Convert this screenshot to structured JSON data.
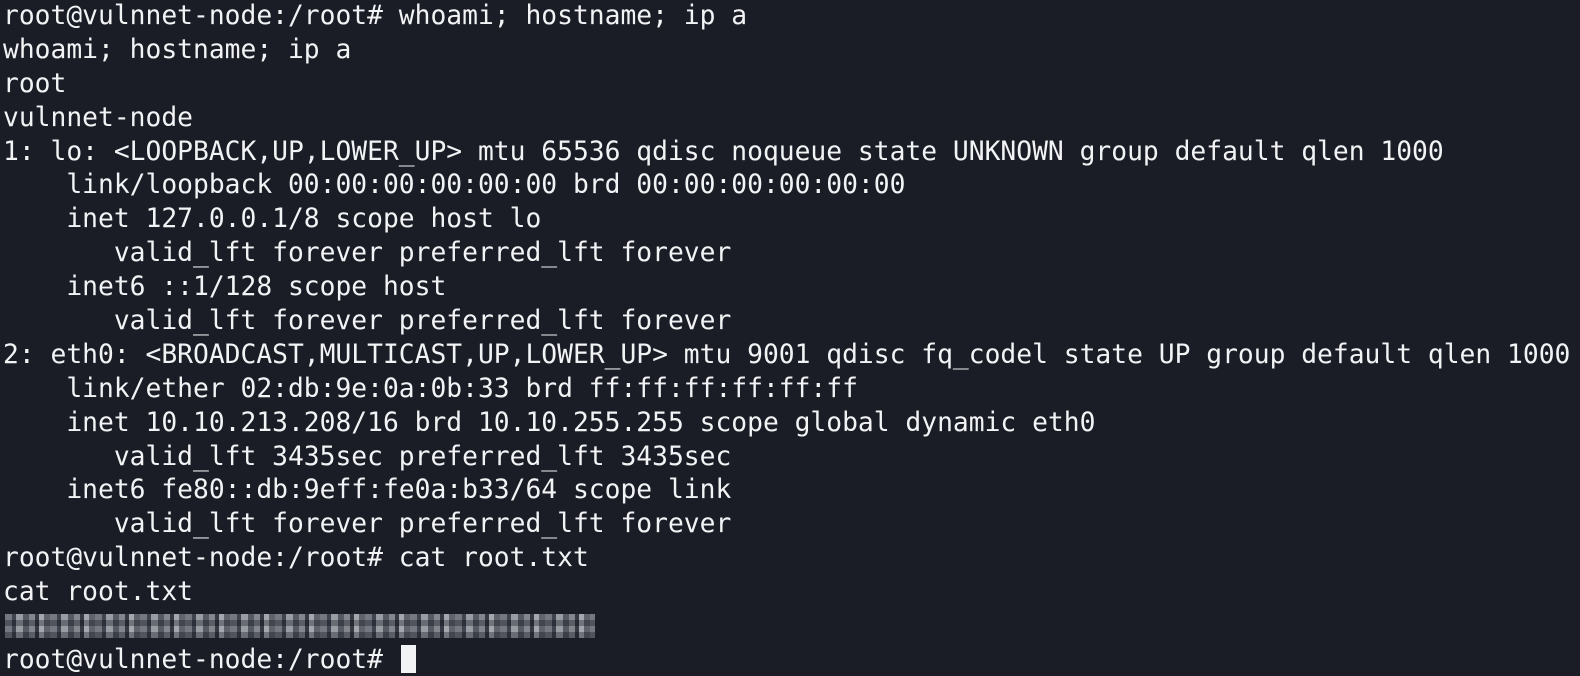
{
  "terminal": {
    "lines": [
      "root@vulnnet-node:/root# whoami; hostname; ip a",
      "whoami; hostname; ip a",
      "root",
      "vulnnet-node",
      "1: lo: <LOOPBACK,UP,LOWER_UP> mtu 65536 qdisc noqueue state UNKNOWN group default qlen 1000",
      "    link/loopback 00:00:00:00:00:00 brd 00:00:00:00:00:00",
      "    inet 127.0.0.1/8 scope host lo",
      "       valid_lft forever preferred_lft forever",
      "    inet6 ::1/128 scope host",
      "       valid_lft forever preferred_lft forever",
      "2: eth0: <BROADCAST,MULTICAST,UP,LOWER_UP> mtu 9001 qdisc fq_codel state UP group default qlen 1000",
      "    link/ether 02:db:9e:0a:0b:33 brd ff:ff:ff:ff:ff:ff",
      "    inet 10.10.213.208/16 brd 10.10.255.255 scope global dynamic eth0",
      "       valid_lft 3435sec preferred_lft 3435sec",
      "    inet6 fe80::db:9eff:fe0a:b33/64 scope link",
      "       valid_lft forever preferred_lft forever",
      "root@vulnnet-node:/root# cat root.txt",
      "cat root.txt"
    ],
    "prompt": "root@vulnnet-node:/root# "
  }
}
